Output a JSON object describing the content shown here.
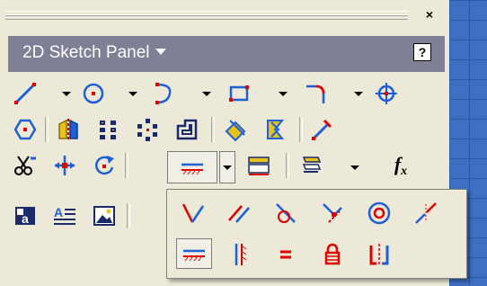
{
  "window": {
    "close_glyph": "×",
    "title": "2D Sketch Panel",
    "help_glyph": "?"
  },
  "toolbar": {
    "formula_label": "f",
    "formula_sub": "x"
  },
  "icons": {
    "row1": [
      "line-icon",
      "circle-icon",
      "arc-icon",
      "rectangle-icon",
      "fillet-icon",
      "point-icon"
    ],
    "row2": [
      "polygon-icon",
      "mirror-icon",
      "rectangular-pattern-icon",
      "circular-pattern-icon",
      "offset-icon",
      "project-geometry-icon",
      "project-cut-edges-icon",
      "project-flat-pattern-icon"
    ],
    "row3": [
      "trim-icon",
      "move-icon",
      "rotate-icon",
      "constraint-icon",
      "show-constraints-icon",
      "auto-dimension-icon",
      "parameters-icon"
    ],
    "row4": [
      "text-icon",
      "geometry-text-icon",
      "insert-image-icon"
    ],
    "popup": [
      "perpendicular-icon",
      "parallel-icon",
      "tangent-icon",
      "coincident-icon",
      "concentric-icon",
      "collinear-icon",
      "horizontal-constraint-icon",
      "vertical-icon",
      "equal-icon",
      "fix-icon",
      "symmetric-icon"
    ]
  },
  "colors": {
    "panel_bg": "#ece9d8",
    "title_bg": "#7f7f95",
    "icon_blue": "#1f5fd6",
    "icon_red": "#e00000",
    "background_blue": "#5b8bd0"
  }
}
